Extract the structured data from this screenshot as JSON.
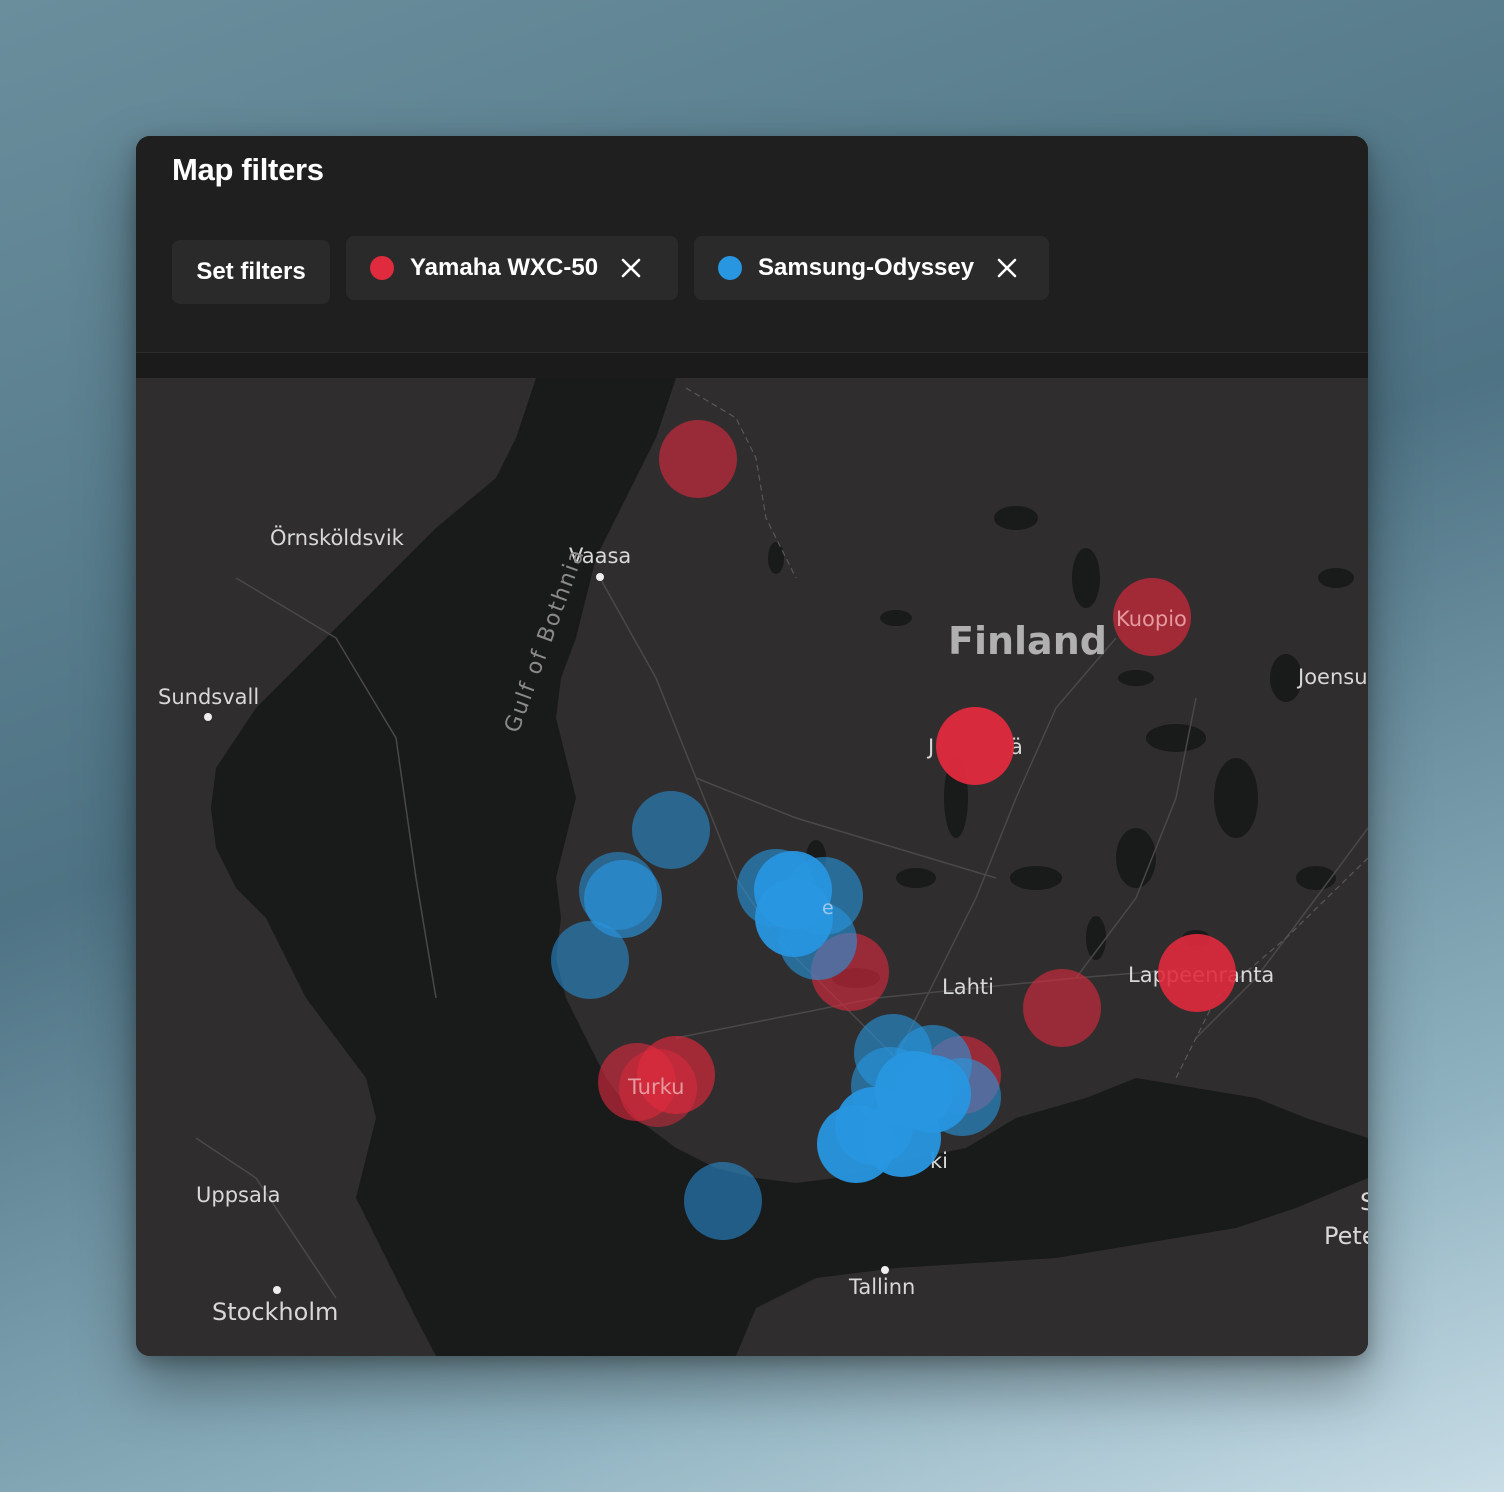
{
  "header": {
    "title": "Map filters",
    "set_filters_label": "Set filters"
  },
  "filters": [
    {
      "label": "Yamaha WXC-50",
      "color": "#e02a3d",
      "icon": "close-icon"
    },
    {
      "label": "Samsung-Odyssey",
      "color": "#2896e0",
      "icon": "close-icon"
    }
  ],
  "map": {
    "sea_label": "Gulf of Bothnia",
    "country_label": "Finland",
    "cities": [
      "Örnsköldsvik",
      "Vaasa",
      "Sundsvall",
      "Kuopio",
      "Joensu",
      "J",
      "ä",
      "Lahti",
      "Lappeenranta",
      "Turku",
      "Uppsala",
      "Stockholm",
      "ki",
      "Tallinn",
      "Pete",
      "S",
      "e"
    ]
  }
}
